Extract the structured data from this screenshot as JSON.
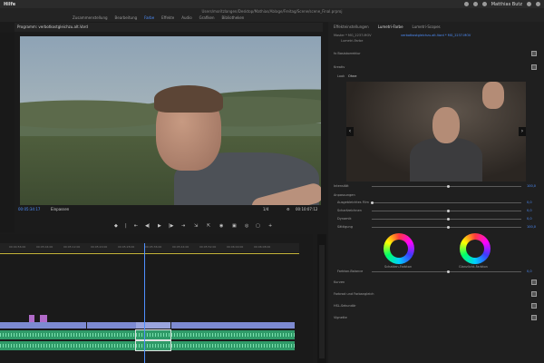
{
  "menubar": {
    "app_name": "Hilfe",
    "user": "Matthias Butz"
  },
  "window": {
    "title": "Users/moritzlangen/Desktop/Mathias/Ablage/Freitag/Scene/scene_Final.prproj"
  },
  "workspaces": [
    {
      "label": "Zusammenstellung",
      "active": false
    },
    {
      "label": "Bearbeitung",
      "active": false
    },
    {
      "label": "Farbe",
      "active": true
    },
    {
      "label": "Effekte",
      "active": false
    },
    {
      "label": "Audio",
      "active": false
    },
    {
      "label": "Grafiken",
      "active": false
    },
    {
      "label": "Bibliotheken",
      "active": false
    }
  ],
  "monitor": {
    "tab_label": "Programm: verbotkostgleichzu.alt.Vord",
    "timecode_current": "00:05:34:17",
    "fit_label": "Einpassen",
    "quality": "1/4",
    "timecode_total": "00:10:07:12"
  },
  "lumetri": {
    "tabs": [
      "Effekteinstellungen",
      "Lumetri-Farbe",
      "Lumetri-Scopes"
    ],
    "source_line": "Master * MG_2237.MOV",
    "clip_line": "verbotkostgleichzu.alt.Vord * MG_2237.MOV",
    "preset": "Lumetri-Farbe",
    "fx_label": "fx Basiskorrektur",
    "section_creative": "Kreativ",
    "look_label": "Look",
    "look_value": "Ohne",
    "intensity_label": "Intensität",
    "intensity_value": "100,0",
    "adjustments_label": "Anpassungen",
    "sliders": [
      {
        "label": "Ausgebleichtes Film",
        "value": "0,0"
      },
      {
        "label": "Scharfzeichnen",
        "value": "0,0"
      },
      {
        "label": "Dynamik",
        "value": "0,0"
      },
      {
        "label": "Sättigung",
        "value": "100,0"
      }
    ],
    "wheel_left_label": "Schatten-Farbton",
    "wheel_right_label": "Glanzlicht-Farbton",
    "balance_label": "Farbton-Balance",
    "balance_value": "0,0",
    "sections": [
      "Kurven",
      "Farbrad und Farbangleich",
      "HSL-Sekundär",
      "Vignette"
    ]
  },
  "timeline": {
    "ruler_ticks": [
      "00:04:56:00",
      "00:05:04:00",
      "00:05:12:00",
      "00:05:20:00",
      "00:05:28:00",
      "00:05:36:00",
      "00:05:44:00",
      "00:05:52:00",
      "00:06:00:00",
      "00:06:08:00"
    ]
  }
}
